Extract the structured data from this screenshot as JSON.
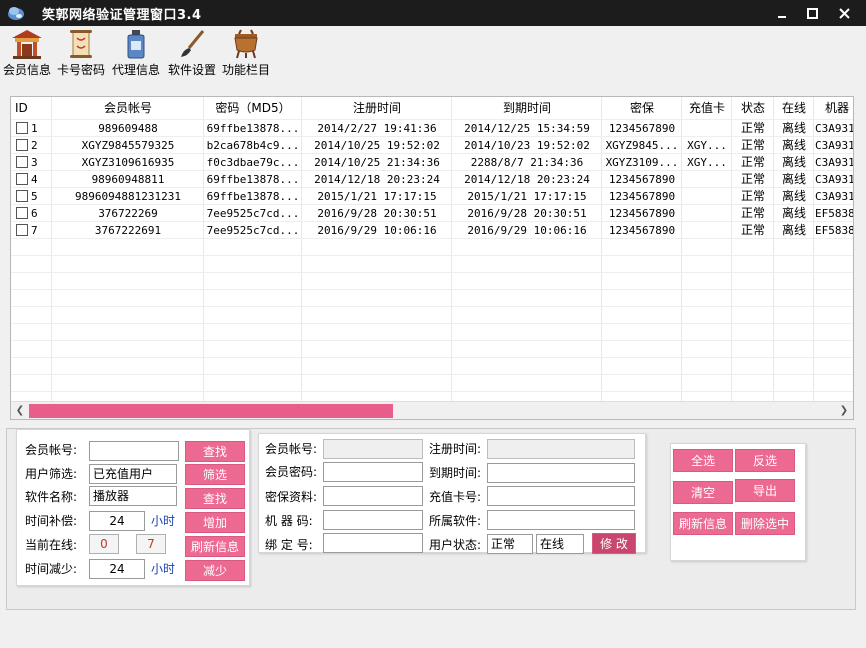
{
  "window": {
    "title": "笑郭网络验证管理窗口3.4"
  },
  "toolbar": {
    "items": [
      {
        "label": "会员信息",
        "icon": "temple-icon"
      },
      {
        "label": "卡号密码",
        "icon": "scroll-icon"
      },
      {
        "label": "代理信息",
        "icon": "bottle-icon"
      },
      {
        "label": "软件设置",
        "icon": "brush-icon"
      },
      {
        "label": "功能栏目",
        "icon": "cauldron-icon"
      }
    ]
  },
  "table": {
    "headers": [
      "ID",
      "会员帐号",
      "密码（MD5）",
      "注册时间",
      "到期时间",
      "密保",
      "充值卡",
      "状态",
      "在线",
      "机器"
    ],
    "rows": [
      [
        "1",
        "989609488",
        "69ffbe13878...",
        "2014/2/27 19:41:36",
        "2014/12/25 15:34:59",
        "1234567890",
        "",
        "正常",
        "离线",
        "C3A931"
      ],
      [
        "2",
        "XGYZ9845579325",
        "b2ca678b4c9...",
        "2014/10/25 19:52:02",
        "2014/10/23 19:52:02",
        "XGYZ9845...",
        "XGY...",
        "正常",
        "离线",
        "C3A931"
      ],
      [
        "3",
        "XGYZ3109616935",
        "f0c3dbae79c...",
        "2014/10/25 21:34:36",
        "2288/8/7 21:34:36",
        "XGYZ3109...",
        "XGY...",
        "正常",
        "离线",
        "C3A931"
      ],
      [
        "4",
        "98960948811",
        "69ffbe13878...",
        "2014/12/18 20:23:24",
        "2014/12/18 20:23:24",
        "1234567890",
        "",
        "正常",
        "离线",
        "C3A931"
      ],
      [
        "5",
        "9896094881231231",
        "69ffbe13878...",
        "2015/1/21 17:17:15",
        "2015/1/21 17:17:15",
        "1234567890",
        "",
        "正常",
        "离线",
        "C3A931"
      ],
      [
        "6",
        "376722269",
        "7ee9525c7cd...",
        "2016/9/28 20:30:51",
        "2016/9/28 20:30:51",
        "1234567890",
        "",
        "正常",
        "离线",
        "EF5838"
      ],
      [
        "7",
        "3767222691",
        "7ee9525c7cd...",
        "2016/9/29 10:06:16",
        "2016/9/29 10:06:16",
        "1234567890",
        "",
        "正常",
        "离线",
        "EF5838"
      ]
    ],
    "scroll_position_fraction": 0.43
  },
  "filter_panel": {
    "member_account_label": "会员帐号:",
    "member_account_value": "",
    "find_button": "查找",
    "user_filter_label": "用户筛选:",
    "user_filter_value": "已充值用户",
    "filter_button": "筛选",
    "software_label": "软件名称:",
    "software_value": "播放器",
    "find_button_2": "查找",
    "time_comp_label": "时间补偿:",
    "time_comp_value": "24",
    "time_comp_unit": "小时",
    "add_button": "增加",
    "online_label": "当前在线:",
    "online_value_1": "0",
    "online_value_2": "7",
    "refresh_button": "刷新信息",
    "time_reduce_label": "时间减少:",
    "time_reduce_value": "24",
    "time_reduce_unit": "小时",
    "reduce_button": "减少"
  },
  "detail_panel": {
    "account_label": "会员帐号:",
    "password_label": "会员密码:",
    "security_label": "密保资料:",
    "machine_label": "机 器 码:",
    "bind_label": "绑 定 号:",
    "reg_time_label": "注册时间:",
    "expire_label": "到期时间:",
    "card_label": "充值卡号:",
    "software_label": "所属软件:",
    "status_label": "用户状态:",
    "status_value": "正常",
    "online_value": "在线",
    "modify_button": "修 改"
  },
  "action_panel": {
    "select_all": "全选",
    "invert": "反选",
    "clear": "清空",
    "export": "导出",
    "refresh": "刷新信息",
    "delete_selected": "删除选中"
  },
  "colors": {
    "accent": "#ec6a92",
    "titlebar": "#1c1c1c",
    "unit_text": "#1c3fb0"
  }
}
